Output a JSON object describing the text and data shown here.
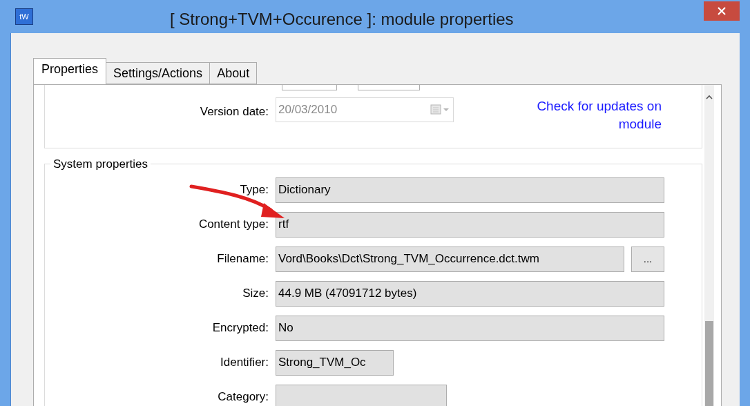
{
  "window": {
    "title": "[ Strong+TVM+Occurence  ]: module properties",
    "app_badge": "tW"
  },
  "tabs": [
    {
      "label": "Properties",
      "selected": true
    },
    {
      "label": "Settings/Actions",
      "selected": false
    },
    {
      "label": "About",
      "selected": false
    }
  ],
  "version_date": {
    "label": "Version date:",
    "value": "20/03/2010",
    "disabled": true
  },
  "update_link": "Check for updates on module",
  "system_properties": {
    "title": "System properties",
    "fields": [
      {
        "label": "Type:",
        "value": "Dictionary",
        "kind": "wide"
      },
      {
        "label": "Content type:",
        "value": "rtf",
        "kind": "wide"
      },
      {
        "label": "Filename:",
        "value": "Vord\\Books\\Dct\\Strong_TVM_Occurrence.dct.twm",
        "kind": "browse",
        "button": "..."
      },
      {
        "label": "Size:",
        "value": "44.9 MB (47091712 bytes)",
        "kind": "wide"
      },
      {
        "label": "Encrypted:",
        "value": "No",
        "kind": "wide"
      },
      {
        "label": "Identifier:",
        "value": "Strong_TVM_Oc",
        "kind": "short"
      },
      {
        "label": "Category:",
        "kind": "medium"
      }
    ]
  }
}
